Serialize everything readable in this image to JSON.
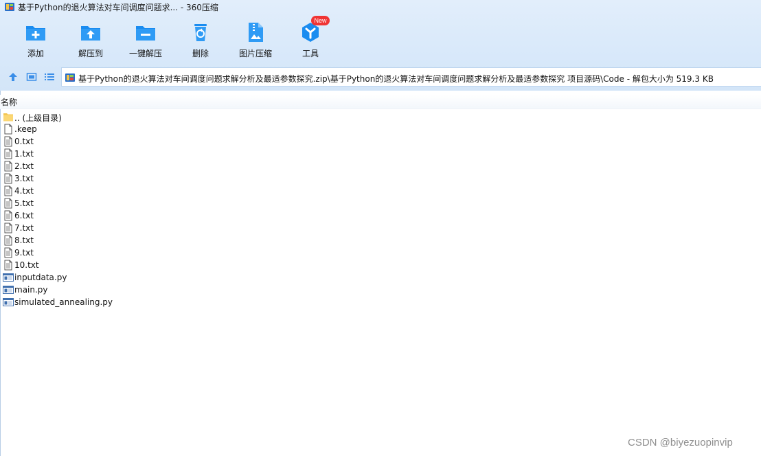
{
  "window": {
    "title": "基于Python的退火算法对车间调度问题求... - 360压缩"
  },
  "toolbar": {
    "items": [
      {
        "label": "添加",
        "icon": "add-icon"
      },
      {
        "label": "解压到",
        "icon": "extract-to-icon"
      },
      {
        "label": "一键解压",
        "icon": "one-click-extract-icon"
      },
      {
        "label": "删除",
        "icon": "delete-icon"
      },
      {
        "label": "图片压缩",
        "icon": "image-compress-icon"
      },
      {
        "label": "工具",
        "icon": "tools-icon"
      }
    ],
    "new_badge": "New"
  },
  "nav": {
    "path": "基于Python的退火算法对车间调度问题求解分析及最适参数探究.zip\\基于Python的退火算法对车间调度问题求解分析及最适参数探究 项目源码\\Code - 解包大小为 519.3 KB"
  },
  "columns": {
    "name": "名称"
  },
  "files": [
    {
      "name": ".. (上级目录)",
      "type": "folder"
    },
    {
      "name": ".keep",
      "type": "blank"
    },
    {
      "name": "0.txt",
      "type": "text"
    },
    {
      "name": "1.txt",
      "type": "text"
    },
    {
      "name": "2.txt",
      "type": "text"
    },
    {
      "name": "3.txt",
      "type": "text"
    },
    {
      "name": "4.txt",
      "type": "text"
    },
    {
      "name": "5.txt",
      "type": "text"
    },
    {
      "name": "6.txt",
      "type": "text"
    },
    {
      "name": "7.txt",
      "type": "text"
    },
    {
      "name": "8.txt",
      "type": "text"
    },
    {
      "name": "9.txt",
      "type": "text"
    },
    {
      "name": "10.txt",
      "type": "text"
    },
    {
      "name": "inputdata.py",
      "type": "python"
    },
    {
      "name": "main.py",
      "type": "python"
    },
    {
      "name": "simulated_annealing.py",
      "type": "python"
    }
  ],
  "watermark": "CSDN @biyezuopinvip",
  "colors": {
    "toolbar_bg": "#d9e9fa",
    "accent_blue": "#1a8cf0",
    "badge_red": "#f03434",
    "folder_yellow": "#fbd774"
  }
}
